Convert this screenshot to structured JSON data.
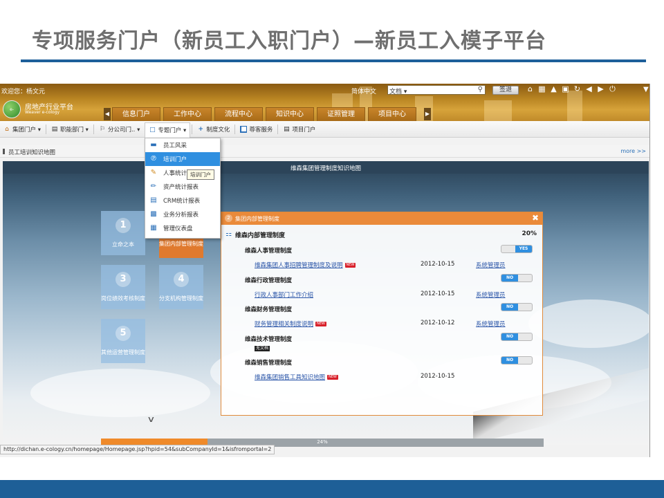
{
  "slide": {
    "title": "专项服务门户（新员工入职门户）—新员工入模子平台"
  },
  "header": {
    "welcome": "欢迎您：杨文元",
    "language": "简体中文",
    "search_type": "文档 ▾",
    "sign_button": "签退",
    "logo_text": "e-cology",
    "platform_name": "房地产行业平台",
    "platform_sub": "Weaver e-cology"
  },
  "nav_tabs": [
    {
      "label": "信息门户",
      "active": true
    },
    {
      "label": "工作中心",
      "active": false
    },
    {
      "label": "流程中心",
      "active": false
    },
    {
      "label": "知识中心",
      "active": false
    },
    {
      "label": "证照管理",
      "active": false
    },
    {
      "label": "项目中心",
      "active": false
    }
  ],
  "toolbar": [
    {
      "label": "集团门户 ▾",
      "icon": "home-icon"
    },
    {
      "label": "职能部门 ▾",
      "icon": "department-icon"
    },
    {
      "label": "分公司门.. ▾",
      "icon": "branch-icon"
    },
    {
      "label": "专题门户 ▾",
      "icon": "topic-icon",
      "active": true
    },
    {
      "label": "制度文化",
      "icon": "plus-icon"
    },
    {
      "label": "尊客服务",
      "icon": "service-icon"
    },
    {
      "label": "项目门户",
      "icon": "project-icon"
    }
  ],
  "dropdown": {
    "items": [
      {
        "label": "员工风采",
        "icon": "card-icon"
      },
      {
        "label": "培训门户",
        "icon": "training-icon",
        "hover": true
      },
      {
        "label": "人事统计",
        "icon": "pencil-icon"
      },
      {
        "label": "资产统计报表",
        "icon": "pen-icon"
      },
      {
        "label": "CRM统计报表",
        "icon": "doc-icon"
      },
      {
        "label": "业务分析报表",
        "icon": "analysis-icon"
      },
      {
        "label": "管理仪表盘",
        "icon": "dashboard-icon"
      }
    ],
    "tooltip": "培训门户"
  },
  "panel": {
    "title": "员工培训知识地图",
    "more": "more >>"
  },
  "map": {
    "title": "维森集团管理制度知识地图"
  },
  "tiles": [
    {
      "num": "1",
      "label": "立命之本"
    },
    {
      "num": "2",
      "label": "集团内部管理制度"
    },
    {
      "num": "3",
      "label": "岗位绩效考核制度"
    },
    {
      "num": "4",
      "label": "分支机构管理制度"
    },
    {
      "num": "5",
      "label": "其他运营管理制度"
    }
  ],
  "popup": {
    "number": "2",
    "title": "集团内部管理制度",
    "root_label": "维森内部管理制度",
    "root_percent": "20%",
    "sections": [
      {
        "title": "维森人事管理制度",
        "toggle": "YES",
        "docs": [
          {
            "title": "维森集团人事招聘管理制度及说明",
            "badge": "NEW",
            "date": "2012-10-15",
            "author": "系统管理员"
          }
        ]
      },
      {
        "title": "维森行政管理制度",
        "toggle": "NO",
        "docs": [
          {
            "title": "行政人事部门工作介绍",
            "badge": "",
            "date": "2012-10-15",
            "author": "系统管理员"
          }
        ]
      },
      {
        "title": "维森财务管理制度",
        "toggle": "NO",
        "docs": [
          {
            "title": "财务管理相关制度说明",
            "badge": "NEW",
            "date": "2012-10-12",
            "author": "系统管理员"
          }
        ]
      },
      {
        "title": "维森技术管理制度",
        "toggle": "NO",
        "empty": "无文档",
        "docs": []
      },
      {
        "title": "维森销售管理制度",
        "toggle": "NO",
        "docs": [
          {
            "title": "维森集团销售工具知识地图",
            "badge": "NEW",
            "date": "2012-10-15",
            "author": ""
          }
        ]
      }
    ]
  },
  "progress": {
    "value": 0.24,
    "label": "24%"
  },
  "status_url": "http://dichan.e-cology.cn/homepage/Homepage.jsp?hpid=54&subCompanyId=1&isfromportal=2",
  "colors": {
    "title_rule": "#1d5f9a",
    "accent_orange": "#ea8a3a",
    "toggle_blue": "#2f8fe0"
  }
}
